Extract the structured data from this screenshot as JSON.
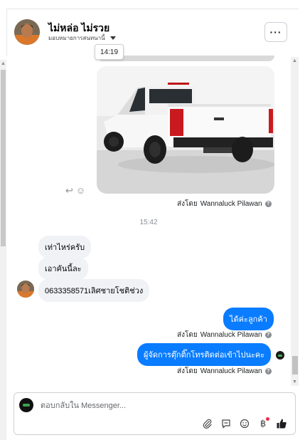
{
  "header": {
    "name": "ไม่หล่อ ไม่รวย",
    "assignment": "มอบหมายการสนทนานี้",
    "more_label": "···"
  },
  "tooltip_time": "14:19",
  "thread": {
    "sent_by_prefix": "ส่งโดย",
    "sender_name": "Wannaluck Pilawan",
    "help_glyph": "?",
    "time_separator": "15:42",
    "incoming": [
      "เท่าไหร่ครับ",
      "เอาคันนี้ละ",
      "0633358571เลิศชายโชติช่วง"
    ],
    "outgoing": [
      "ได้ค่ะลูกค้า",
      "ผู้จัดการตุ๊กติ๊กโทรติดต่อเข้าไปนะคะ"
    ]
  },
  "composer": {
    "placeholder": "ตอบกลับใน Messenger...",
    "tools": [
      "paperclip-icon",
      "quick-reply-icon",
      "emoji-icon",
      "baht-icon",
      "thumbs-up-icon"
    ],
    "baht_glyph": "฿"
  },
  "colors": {
    "outgoing_bubble": "#0a7cff",
    "incoming_bubble": "#f0f2f5",
    "car_body": "#f5f5f5"
  }
}
